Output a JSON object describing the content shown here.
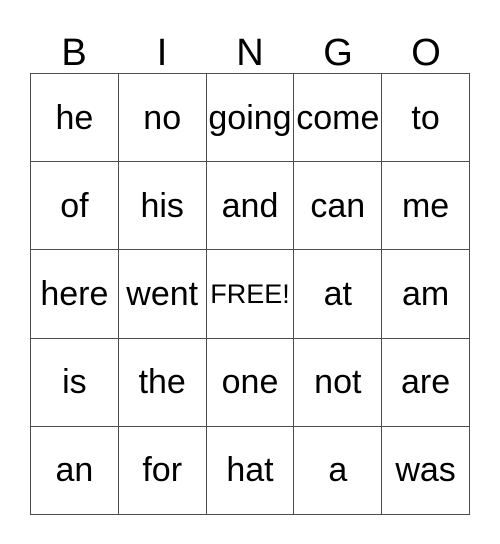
{
  "card": {
    "header_letters": [
      "B",
      "I",
      "N",
      "G",
      "O"
    ],
    "grid_rows": 5,
    "grid_columns": 5,
    "free_space": {
      "row": 2,
      "column": 2,
      "label": "FREE!"
    },
    "colors": {
      "background": "#ffffff",
      "text": "#000000",
      "grid_line": "#4d4d4d"
    },
    "rows": [
      {
        "cells": [
          {
            "text": "he"
          },
          {
            "text": "no"
          },
          {
            "text": "going"
          },
          {
            "text": "come"
          },
          {
            "text": "to"
          }
        ]
      },
      {
        "cells": [
          {
            "text": "of"
          },
          {
            "text": "his"
          },
          {
            "text": "and"
          },
          {
            "text": "can"
          },
          {
            "text": "me"
          }
        ]
      },
      {
        "cells": [
          {
            "text": "here"
          },
          {
            "text": "went"
          },
          {
            "text": "FREE!"
          },
          {
            "text": "at"
          },
          {
            "text": "am"
          }
        ]
      },
      {
        "cells": [
          {
            "text": "is"
          },
          {
            "text": "the"
          },
          {
            "text": "one"
          },
          {
            "text": "not"
          },
          {
            "text": "are"
          }
        ]
      },
      {
        "cells": [
          {
            "text": "an"
          },
          {
            "text": "for"
          },
          {
            "text": "hat"
          },
          {
            "text": "a"
          },
          {
            "text": "was"
          }
        ]
      }
    ]
  }
}
